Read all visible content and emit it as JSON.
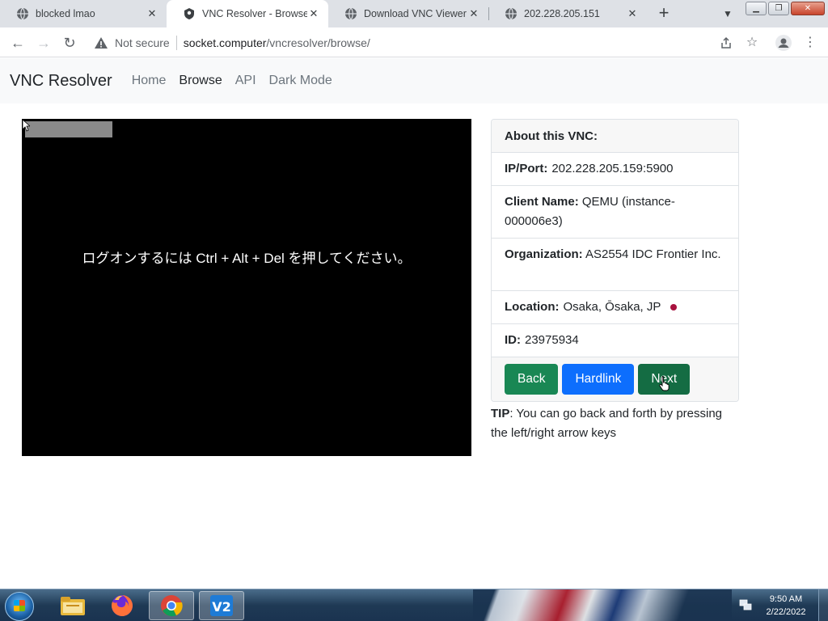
{
  "browser": {
    "tabs": [
      {
        "title": "blocked lmao",
        "icon": "globe-icon",
        "active": false
      },
      {
        "title": "VNC Resolver - Browse",
        "icon": "site-icon",
        "active": true
      },
      {
        "title": "Download VNC Viewer fo",
        "icon": "globe-icon",
        "active": false
      },
      {
        "title": "202.228.205.151",
        "icon": "globe-icon",
        "active": false
      }
    ],
    "new_tab": "+",
    "address": {
      "security_label": "Not secure",
      "host": "socket.computer",
      "path": "/vncresolver/browse/"
    }
  },
  "site": {
    "brand": "VNC Resolver",
    "nav": [
      {
        "label": "Home",
        "active": false
      },
      {
        "label": "Browse",
        "active": true
      },
      {
        "label": "API",
        "active": false
      },
      {
        "label": "Dark Mode",
        "active": false
      }
    ]
  },
  "screenshot": {
    "message": "ログオンするには Ctrl + Alt + Del を押してください。"
  },
  "about": {
    "title": "About this VNC:",
    "ip_port_label": "IP/Port:",
    "ip_port": "202.228.205.159:5900",
    "client_label": "Client Name:",
    "client": "QEMU (instance-000006e3)",
    "org_label": "Organization:",
    "org": "AS2554 IDC Frontier Inc.",
    "location_label": "Location:",
    "location": "Osaka, Ōsaka, JP",
    "location_dot_color": "#a8123e",
    "id_label": "ID:",
    "id": "23975934",
    "buttons": {
      "back": "Back",
      "hardlink": "Hardlink",
      "next": "Next"
    }
  },
  "tip": {
    "label": "TIP",
    "text": ": You can go back and forth by pressing the left/right arrow keys"
  },
  "taskbar": {
    "time": "9:50 AM",
    "date": "2/22/2022",
    "apps": [
      "explorer-icon",
      "firefox-icon",
      "chrome-icon",
      "vnc-viewer-icon"
    ]
  },
  "colors": {
    "green": "#198754",
    "blue": "#0d6efd"
  }
}
